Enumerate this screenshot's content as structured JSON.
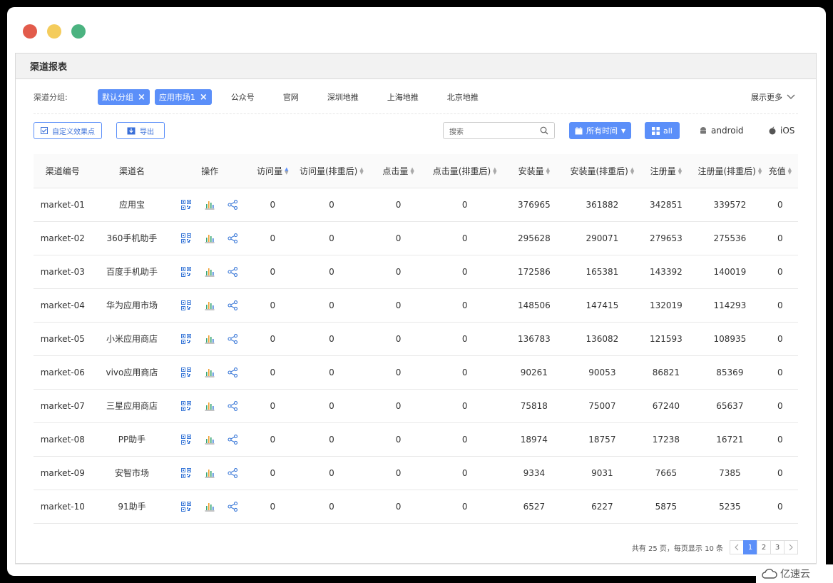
{
  "window": {
    "dots": [
      "#e25b4b",
      "#f4cc5c",
      "#4bb380"
    ]
  },
  "panel": {
    "title": "渠道报表"
  },
  "group": {
    "label": "渠道分组:",
    "selected": [
      "默认分组",
      "应用市场1"
    ],
    "options": [
      "公众号",
      "官网",
      "深圳地推",
      "上海地推",
      "北京地推"
    ],
    "more_label": "展示更多"
  },
  "toolbar": {
    "custom_label": "自定义效果点",
    "export_label": "导出",
    "search_placeholder": "搜索",
    "time_label": "所有时间",
    "all_label": "all",
    "android_label": "android",
    "ios_label": "iOS"
  },
  "table": {
    "headers": {
      "id": "渠道编号",
      "name": "渠道名",
      "ops": "操作",
      "visits": "访问量",
      "visits_dedup": "访问量(排重后)",
      "clicks": "点击量",
      "clicks_dedup": "点击量(排重后)",
      "installs": "安装量",
      "installs_dedup": "安装量(排重后)",
      "regs": "注册量",
      "regs_dedup": "注册量(排重后)",
      "recharge": "充值"
    },
    "rows": [
      {
        "id": "market-01",
        "name": "应用宝",
        "visits": "0",
        "visits_dedup": "0",
        "clicks": "0",
        "clicks_dedup": "0",
        "installs": "376965",
        "installs_dedup": "361882",
        "regs": "342851",
        "regs_dedup": "339572",
        "recharge": "0"
      },
      {
        "id": "market-02",
        "name": "360手机助手",
        "visits": "0",
        "visits_dedup": "0",
        "clicks": "0",
        "clicks_dedup": "0",
        "installs": "295628",
        "installs_dedup": "290071",
        "regs": "279653",
        "regs_dedup": "275536",
        "recharge": "0"
      },
      {
        "id": "market-03",
        "name": "百度手机助手",
        "visits": "0",
        "visits_dedup": "0",
        "clicks": "0",
        "clicks_dedup": "0",
        "installs": "172586",
        "installs_dedup": "165381",
        "regs": "143392",
        "regs_dedup": "140019",
        "recharge": "0"
      },
      {
        "id": "market-04",
        "name": "华为应用市场",
        "visits": "0",
        "visits_dedup": "0",
        "clicks": "0",
        "clicks_dedup": "0",
        "installs": "148506",
        "installs_dedup": "147415",
        "regs": "132019",
        "regs_dedup": "114293",
        "recharge": "0"
      },
      {
        "id": "market-05",
        "name": "小米应用商店",
        "visits": "0",
        "visits_dedup": "0",
        "clicks": "0",
        "clicks_dedup": "0",
        "installs": "136783",
        "installs_dedup": "136082",
        "regs": "121593",
        "regs_dedup": "108935",
        "recharge": "0"
      },
      {
        "id": "market-06",
        "name": "vivo应用商店",
        "visits": "0",
        "visits_dedup": "0",
        "clicks": "0",
        "clicks_dedup": "0",
        "installs": "90261",
        "installs_dedup": "90053",
        "regs": "86821",
        "regs_dedup": "85369",
        "recharge": "0"
      },
      {
        "id": "market-07",
        "name": "三星应用商店",
        "visits": "0",
        "visits_dedup": "0",
        "clicks": "0",
        "clicks_dedup": "0",
        "installs": "75818",
        "installs_dedup": "75007",
        "regs": "67240",
        "regs_dedup": "65637",
        "recharge": "0"
      },
      {
        "id": "market-08",
        "name": "PP助手",
        "visits": "0",
        "visits_dedup": "0",
        "clicks": "0",
        "clicks_dedup": "0",
        "installs": "18974",
        "installs_dedup": "18757",
        "regs": "17238",
        "regs_dedup": "16721",
        "recharge": "0"
      },
      {
        "id": "market-09",
        "name": "安智市场",
        "visits": "0",
        "visits_dedup": "0",
        "clicks": "0",
        "clicks_dedup": "0",
        "installs": "9334",
        "installs_dedup": "9031",
        "regs": "7665",
        "regs_dedup": "7385",
        "recharge": "0"
      },
      {
        "id": "market-10",
        "name": "91助手",
        "visits": "0",
        "visits_dedup": "0",
        "clicks": "0",
        "clicks_dedup": "0",
        "installs": "6527",
        "installs_dedup": "6227",
        "regs": "5875",
        "regs_dedup": "5235",
        "recharge": "0"
      }
    ],
    "row_icons": [
      "qrcode-icon",
      "bar-chart-icon",
      "share-icon"
    ]
  },
  "pagination": {
    "info": "共有 25 页，每页显示 10 条",
    "pages": [
      "1",
      "2",
      "3"
    ],
    "current": "1"
  },
  "watermark": {
    "text": "亿速云"
  },
  "colors": {
    "accent": "#5b8ff9",
    "icon_blue": "#3a78d8",
    "icon_green": "#3aa776",
    "icon_orange": "#f0a030"
  }
}
